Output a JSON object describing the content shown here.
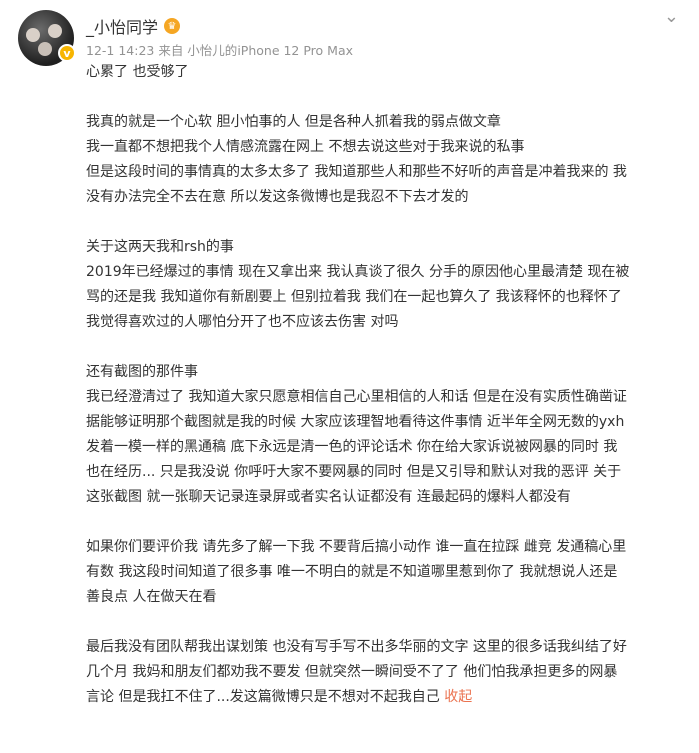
{
  "user": {
    "name": "_小怡同学",
    "meta": "12-1 14:23  来自 小怡儿的iPhone 12 Pro Max"
  },
  "icons": {
    "verified": "verified-badge-icon",
    "crown": "vip-crown-icon",
    "more": "chevron-down-icon"
  },
  "post": {
    "p1": [
      "心累了 也受够了"
    ],
    "p2": [
      "我真的就是一个心软 胆小怕事的人 但是各种人抓着我的弱点做文章",
      "我一直都不想把我个人情感流露在网上 不想去说这些对于我来说的私事",
      "但是这段时间的事情真的太多太多了 我知道那些人和那些不好听的声音是冲着我来的 我",
      "没有办法完全不去在意 所以发这条微博也是我忍不下去才发的"
    ],
    "p3": [
      "关于这两天我和rsh的事",
      "2019年已经爆过的事情 现在又拿出来 我认真谈了很久 分手的原因他心里最清楚 现在被",
      "骂的还是我 我知道你有新剧要上 但别拉着我 我们在一起也算久了 我该释怀的也释怀了",
      "我觉得喜欢过的人哪怕分开了也不应该去伤害 对吗"
    ],
    "p4": [
      "还有截图的那件事",
      "我已经澄清过了 我知道大家只愿意相信自己心里相信的人和话 但是在没有实质性确凿证",
      "据能够证明那个截图就是我的时候 大家应该理智地看待这件事情 近半年全网无数的yxh",
      "发着一模一样的黑通稿 底下永远是清一色的评论话术 你在给大家诉说被网暴的同时 我",
      "也在经历... 只是我没说 你呼吁大家不要网暴的同时 但是又引导和默认对我的恶评 关于",
      "这张截图 就一张聊天记录连录屏或者实名认证都没有 连最起码的爆料人都没有"
    ],
    "p5": [
      "如果你们要评价我 请先多了解一下我 不要背后搞小动作 谁一直在拉踩 雌竞 发通稿心里",
      "有数 我这段时间知道了很多事 唯一不明白的就是不知道哪里惹到你了 我就想说人还是",
      "善良点 人在做天在看"
    ],
    "p6": [
      "最后我没有团队帮我出谋划策 也没有写手写不出多华丽的文字 这里的很多话我纠结了好",
      "几个月 我妈和朋友们都劝我不要发 但就突然一瞬间受不了了 他们怕我承担更多的网暴",
      "言论 但是我扛不住了...发这篇微博只是不想对不起我自己 "
    ],
    "fold_label": "收起"
  }
}
